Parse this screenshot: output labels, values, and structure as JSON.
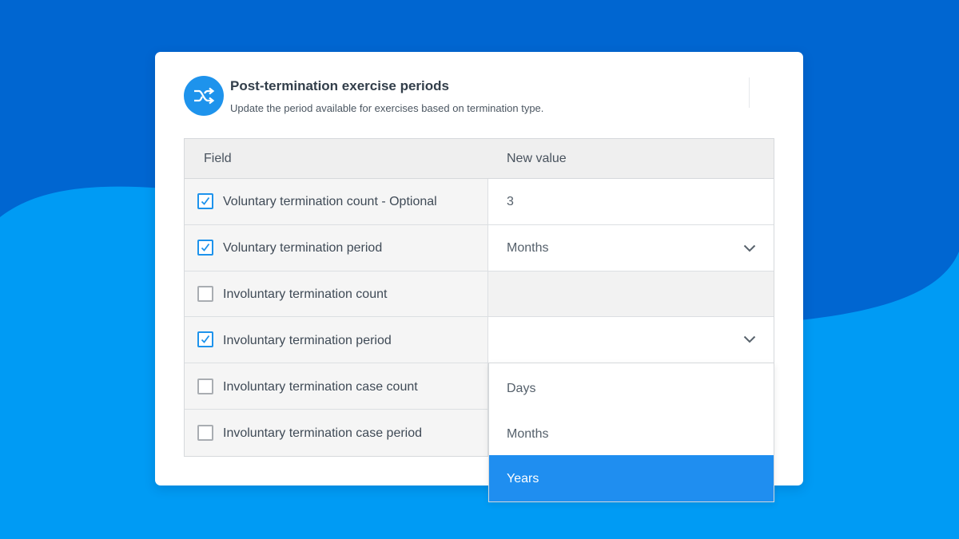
{
  "colors": {
    "background_light": "#009bf4",
    "background_dark": "#0066d1",
    "accent": "#1e93ec",
    "selected_option": "#1f8ef0"
  },
  "header": {
    "icon": "shuffle-icon",
    "title": "Post-termination exercise periods",
    "subtitle": "Update the period available for exercises based on termination type."
  },
  "table": {
    "columns": {
      "field": "Field",
      "value": "New value"
    },
    "rows": [
      {
        "label": "Voluntary termination count - Optional",
        "checked": true,
        "value": "3",
        "input": "text"
      },
      {
        "label": "Voluntary termination period",
        "checked": true,
        "value": "Months",
        "input": "select"
      },
      {
        "label": "Involuntary termination count",
        "checked": false,
        "value": "",
        "input": "disabled"
      },
      {
        "label": "Involuntary termination period",
        "checked": true,
        "value": "",
        "input": "select-open"
      },
      {
        "label": "Involuntary termination case count",
        "checked": false,
        "value": "",
        "input": "disabled"
      },
      {
        "label": "Involuntary termination case period",
        "checked": false,
        "value": "",
        "input": "disabled"
      }
    ]
  },
  "dropdown": {
    "options": [
      "Days",
      "Months",
      "Years"
    ],
    "highlighted": "Years"
  }
}
